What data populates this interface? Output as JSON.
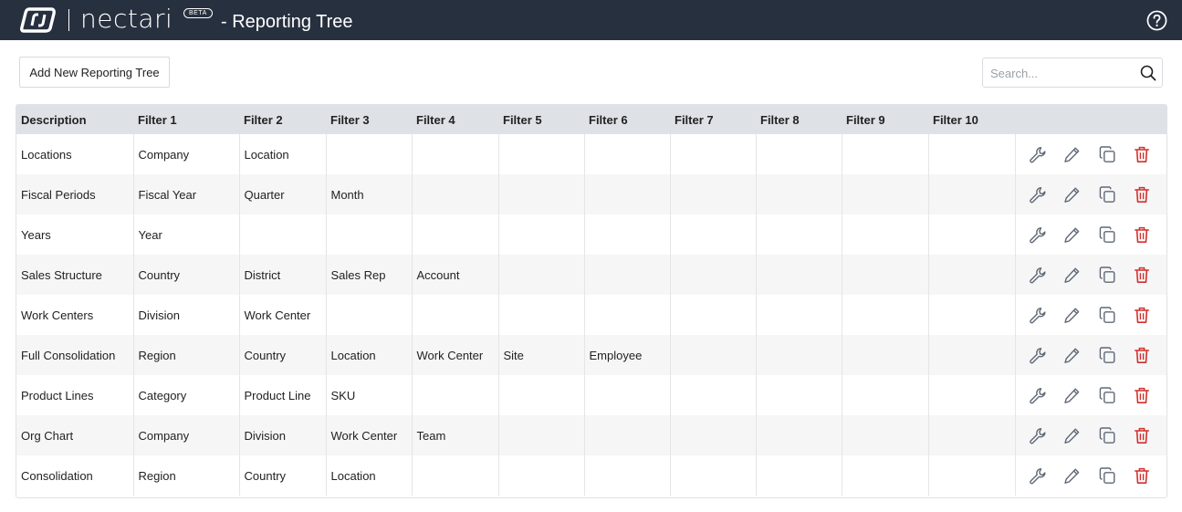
{
  "header": {
    "brand": "nectari",
    "badge": "BETA",
    "title": "- Reporting Tree",
    "help_icon": "question-circle-icon"
  },
  "toolbar": {
    "add_label": "Add New Reporting Tree",
    "search_placeholder": "Search...",
    "search_value": "",
    "search_icon": "magnifier-icon"
  },
  "table": {
    "columns": [
      "Description",
      "Filter 1",
      "Filter 2",
      "Filter 3",
      "Filter 4",
      "Filter 5",
      "Filter 6",
      "Filter 7",
      "Filter 8",
      "Filter 9",
      "Filter 10"
    ],
    "rows": [
      [
        "Locations",
        "Company",
        "Location",
        "",
        "",
        "",
        "",
        "",
        "",
        "",
        ""
      ],
      [
        "Fiscal Periods",
        "Fiscal Year",
        "Quarter",
        "Month",
        "",
        "",
        "",
        "",
        "",
        "",
        ""
      ],
      [
        "Years",
        "Year",
        "",
        "",
        "",
        "",
        "",
        "",
        "",
        "",
        ""
      ],
      [
        "Sales Structure",
        "Country",
        "District",
        "Sales Rep",
        "Account",
        "",
        "",
        "",
        "",
        "",
        ""
      ],
      [
        "Work Centers",
        "Division",
        "Work Center",
        "",
        "",
        "",
        "",
        "",
        "",
        "",
        ""
      ],
      [
        "Full Consolidation",
        "Region",
        "Country",
        "Location",
        "Work Center",
        "Site",
        "Employee",
        "",
        "",
        "",
        ""
      ],
      [
        "Product Lines",
        "Category",
        "Product Line",
        "SKU",
        "",
        "",
        "",
        "",
        "",
        "",
        ""
      ],
      [
        "Org Chart",
        "Company",
        "Division",
        "Work Center",
        "Team",
        "",
        "",
        "",
        "",
        "",
        ""
      ],
      [
        "Consolidation",
        "Region",
        "Country",
        "Location",
        "",
        "",
        "",
        "",
        "",
        "",
        ""
      ]
    ],
    "row_actions": [
      "wrench-icon",
      "pencil-icon",
      "copy-icon",
      "trash-icon"
    ]
  },
  "colors": {
    "header_bg": "#27303f",
    "table_header_bg": "#dee1e6",
    "stripe_bg": "#f6f6f7",
    "icon_gray": "#5f6875",
    "delete_red": "#d2302c"
  }
}
